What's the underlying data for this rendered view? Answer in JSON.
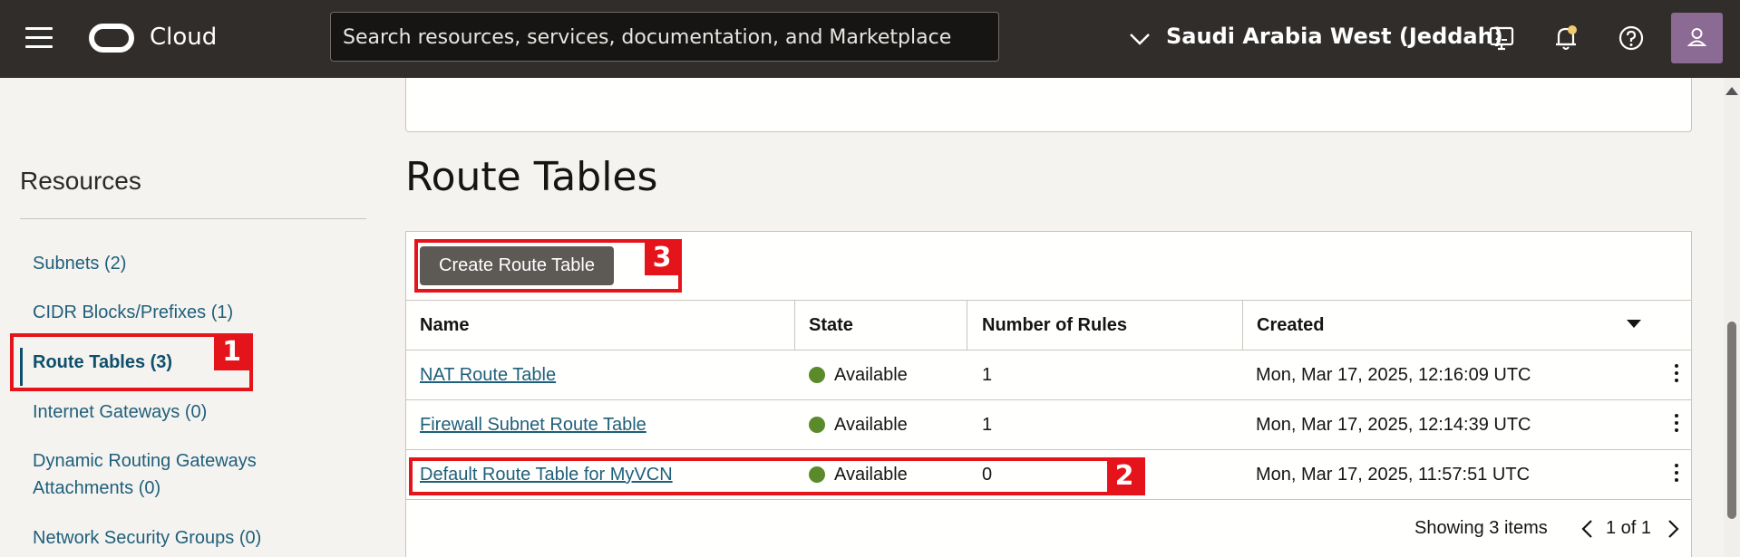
{
  "header": {
    "brand": "Cloud",
    "search_placeholder": "Search resources, services, documentation, and Marketplace",
    "region": "Saudi Arabia West (Jeddah)"
  },
  "sidebar": {
    "title": "Resources",
    "items": [
      {
        "label": "Subnets (2)"
      },
      {
        "label": "CIDR Blocks/Prefixes (1)"
      },
      {
        "label": "Route Tables (3)"
      },
      {
        "label": "Internet Gateways (0)"
      },
      {
        "label": "Dynamic Routing Gateways"
      },
      {
        "label": "Attachments (0)"
      },
      {
        "label": "Network Security Groups (0)"
      }
    ]
  },
  "main": {
    "title": "Route Tables",
    "create_button": "Create Route Table",
    "columns": [
      "Name",
      "State",
      "Number of Rules",
      "Created"
    ],
    "rows": [
      {
        "name": "NAT Route Table",
        "state": "Available",
        "rules": "1",
        "created": "Mon, Mar 17, 2025, 12:16:09 UTC"
      },
      {
        "name": "Firewall Subnet Route Table",
        "state": "Available",
        "rules": "1",
        "created": "Mon, Mar 17, 2025, 12:14:39 UTC"
      },
      {
        "name": "Default Route Table for MyVCN",
        "state": "Available",
        "rules": "0",
        "created": "Mon, Mar 17, 2025, 11:57:51 UTC"
      }
    ],
    "showing": "Showing 3 items",
    "page_info": "1 of 1"
  },
  "annotations": [
    "1",
    "2",
    "3"
  ],
  "colors": {
    "annotation": "#e5131a",
    "available": "#5b8a2b",
    "link": "#1f5f7a",
    "topbar": "#312d2a"
  },
  "icons": [
    "hamburger-icon",
    "oracle-logo-icon",
    "chevron-down-icon",
    "cloud-shell-icon",
    "bell-icon",
    "help-icon",
    "user-icon",
    "kebab-icon",
    "chevron-left-icon",
    "chevron-right-icon"
  ]
}
